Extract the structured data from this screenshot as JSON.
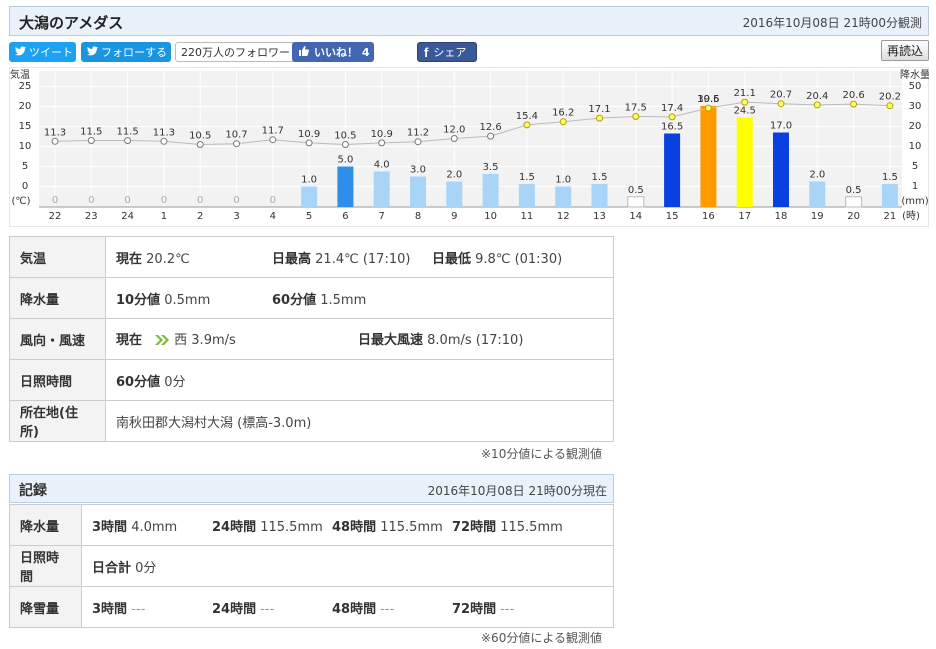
{
  "header": {
    "title": "大潟のアメダス",
    "observed": "2016年10月08日 21時00分観測"
  },
  "social": {
    "tweet": "ツイート",
    "follow": "フォローする",
    "followers": "220万人のフォロワー",
    "like": "いいね！ 4",
    "share": "シェア",
    "reload": "再読込"
  },
  "chart_data": {
    "type": "bar+line",
    "left_axis_label": "気温",
    "left_unit": "(℃)",
    "right_axis_label": "降水量",
    "right_unit": "(mm)",
    "x_unit": "(時)",
    "left_ticks": [
      "25",
      "20",
      "15",
      "10",
      "5",
      "0"
    ],
    "right_ticks": [
      "50",
      "30",
      "20",
      "10",
      "5",
      "1"
    ],
    "hours": [
      "22",
      "23",
      "24",
      "1",
      "2",
      "3",
      "4",
      "5",
      "6",
      "7",
      "8",
      "9",
      "10",
      "11",
      "12",
      "13",
      "14",
      "15",
      "16",
      "17",
      "18",
      "19",
      "20",
      "21"
    ],
    "temperature": [
      11.3,
      11.5,
      11.5,
      11.3,
      10.5,
      10.7,
      11.7,
      10.9,
      10.5,
      10.9,
      11.2,
      12.0,
      12.6,
      15.4,
      16.2,
      17.1,
      17.5,
      17.4,
      19.6,
      21.1,
      20.7,
      20.4,
      20.6,
      20.2
    ],
    "temperature_labels": [
      "11.3",
      "11.5",
      "11.5",
      "11.3",
      "10.5",
      "10.7",
      "11.7",
      "10.9",
      "10.5",
      "10.9",
      "11.2",
      "12.0",
      "12.6",
      "15.4",
      "16.2",
      "17.1",
      "17.5",
      "17.4",
      "19.6",
      "21.1",
      "20.7",
      "20.4",
      "20.6",
      "20.2"
    ],
    "precipitation": [
      0,
      0,
      0,
      0,
      0,
      0,
      0,
      1.0,
      5.0,
      4.0,
      3.0,
      2.0,
      3.5,
      1.5,
      1.0,
      1.5,
      0.5,
      16.5,
      30.5,
      24.5,
      17.0,
      2.0,
      0.5,
      1.5
    ],
    "precipitation_labels": [
      "0",
      "0",
      "0",
      "0",
      "0",
      "0",
      "0",
      "1.0",
      "5.0",
      "4.0",
      "3.0",
      "2.0",
      "3.5",
      "1.5",
      "1.0",
      "1.5",
      "0.5",
      "16.5",
      "30.5",
      "24.5",
      "17.0",
      "2.0",
      "0.5",
      "1.5"
    ],
    "colors": {
      "light": "#a8d4f8",
      "mid": "#2f8fe8",
      "heavy": "#0a3fe0",
      "orange": "#ff9a00",
      "yellow": "#ffff00",
      "white": "#ffffff",
      "temp_line": "#bbbbbb",
      "temp_point_day": "#ffff66",
      "temp_point_night": "#ffffff"
    }
  },
  "current": {
    "rows": [
      {
        "label": "気温",
        "now_k": "現在",
        "now_v": "20.2℃",
        "max_k": "日最高",
        "max_v": "21.4℃ (17:10)",
        "min_k": "日最低",
        "min_v": "9.8℃ (01:30)"
      },
      {
        "label": "降水量",
        "p10_k": "10分値",
        "p10_v": "0.5mm",
        "p60_k": "60分値",
        "p60_v": "1.5mm"
      },
      {
        "label": "風向・風速",
        "now_k": "現在",
        "now_v": "西 3.9m/s",
        "max_k": "日最大風速",
        "max_v": "8.0m/s (17:10)"
      },
      {
        "label": "日照時間",
        "k": "60分値",
        "v": "0分"
      },
      {
        "label": "所在地(住所)",
        "v": "南秋田郡大潟村大潟 (標高-3.0m)"
      }
    ],
    "note": "※10分値による観測値"
  },
  "records": {
    "title": "記録",
    "observed": "2016年10月08日 21時00分現在",
    "rows": [
      {
        "label": "降水量",
        "cells": [
          {
            "k": "3時間",
            "v": "4.0mm"
          },
          {
            "k": "24時間",
            "v": "115.5mm"
          },
          {
            "k": "48時間",
            "v": "115.5mm"
          },
          {
            "k": "72時間",
            "v": "115.5mm"
          }
        ]
      },
      {
        "label": "日照時間",
        "k": "日合計",
        "v": "0分"
      },
      {
        "label": "降雪量",
        "cells": [
          {
            "k": "3時間",
            "v": "---"
          },
          {
            "k": "24時間",
            "v": "---"
          },
          {
            "k": "48時間",
            "v": "---"
          },
          {
            "k": "72時間",
            "v": "---"
          }
        ]
      }
    ],
    "note": "※60分値による観測値"
  }
}
